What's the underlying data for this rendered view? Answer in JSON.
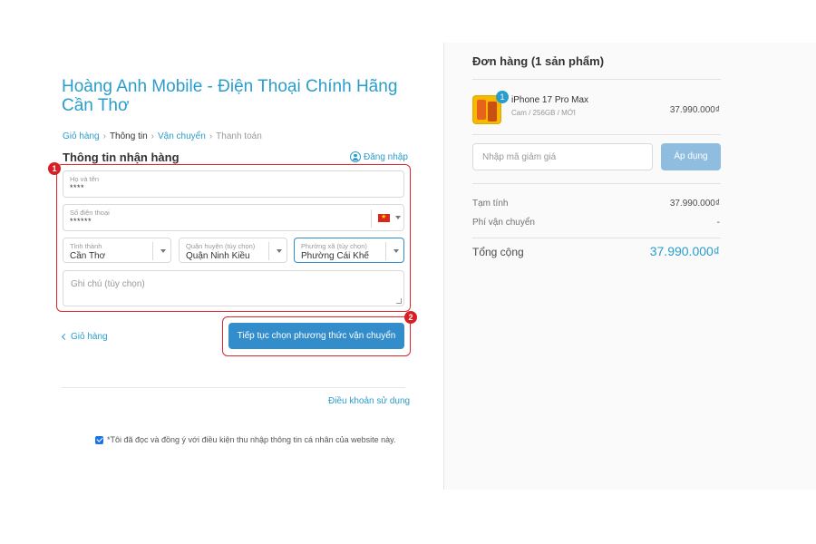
{
  "store": {
    "title": "Hoàng Anh Mobile - Điện Thoại Chính Hãng Cần Thơ"
  },
  "breadcrumb": {
    "items": [
      "Giỏ hàng",
      "Thông tin",
      "Vận chuyển",
      "Thanh toán"
    ],
    "separator": "›"
  },
  "form": {
    "section_title": "Thông tin nhận hàng",
    "login_label": "Đăng nhập",
    "name": {
      "label": "Họ và tên",
      "value": "****"
    },
    "phone": {
      "label": "Số điện thoại",
      "value": "******",
      "country_flag": "vietnam-flag-icon"
    },
    "province": {
      "label": "Tỉnh thành",
      "value": "Cần Thơ"
    },
    "district": {
      "label": "Quận huyện (tùy chọn)",
      "value": "Quận Ninh Kiều"
    },
    "ward": {
      "label": "Phường xã (tùy chọn)",
      "value": "Phường Cái Khế"
    },
    "note": {
      "placeholder": "Ghi chú (tùy chọn)"
    },
    "back_label": "Giỏ hàng",
    "continue_label": "Tiếp tục chọn phương thức vận chuyển"
  },
  "annotations": {
    "step1": "1",
    "step2": "2"
  },
  "footer": {
    "terms_label": "Điều khoản sử dụng",
    "consent_text": "*Tôi đã đọc và đồng ý với điều kiện thu nhập thông tin cá nhân của website này.",
    "consent_checked": true
  },
  "summary": {
    "title": "Đơn hàng (1 sản phẩm)",
    "product": {
      "name": "iPhone 17 Pro Max",
      "variant": "Cam / 256GB / MỚI",
      "price": "37.990.000₫",
      "quantity": "1"
    },
    "discount": {
      "placeholder": "Nhập mã giảm giá",
      "apply_label": "Áp dụng"
    },
    "subtotal_label": "Tạm tính",
    "subtotal_value": "37.990.000₫",
    "shipping_label": "Phí vận chuyển",
    "shipping_value": "-",
    "total_label": "Tổng cộng",
    "total_value": "37.990.000₫"
  },
  "colors": {
    "accent": "#2a9dcc",
    "button": "#338dcb",
    "apply_button": "#8fbde0",
    "highlight": "#e0252e"
  }
}
